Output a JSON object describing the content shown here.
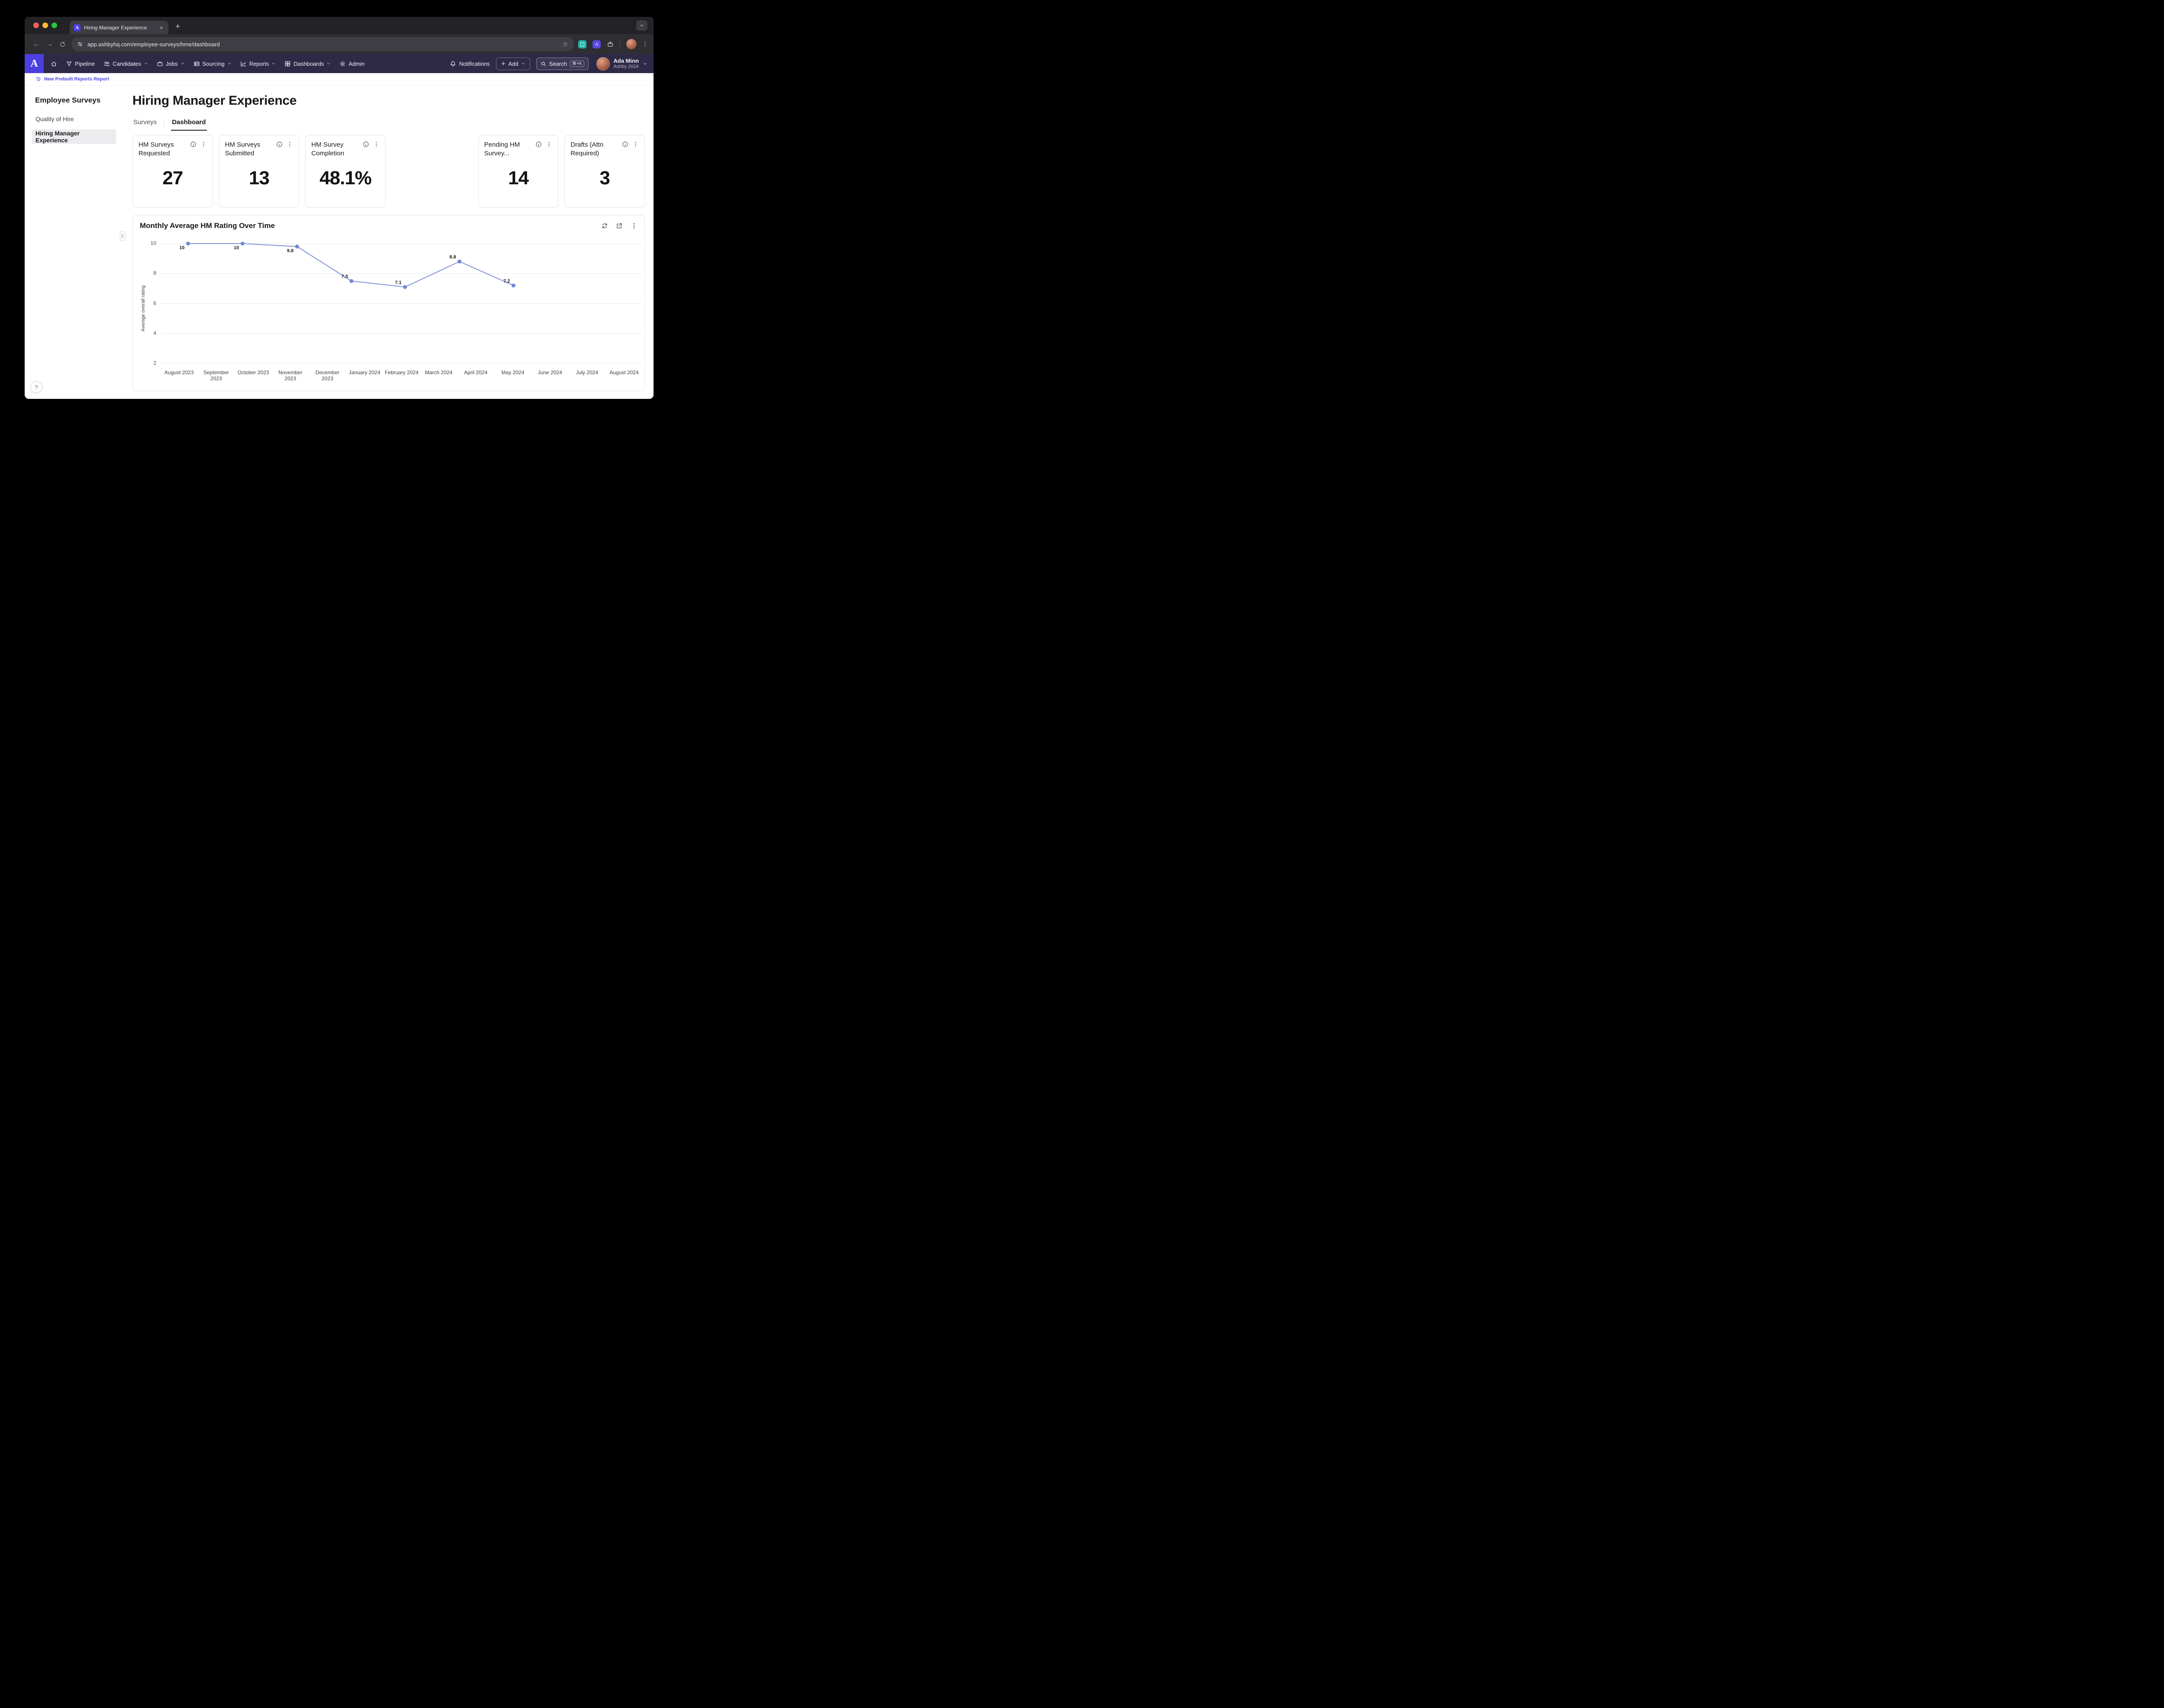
{
  "browser": {
    "tab_title": "Hiring Manager Experience",
    "url": "app.ashbyhq.com/employee-surveys/hme/dashboard"
  },
  "app_nav": {
    "logo_letter": "A",
    "items": [
      {
        "label": "",
        "icon": "home-icon",
        "chevron": false
      },
      {
        "label": "Pipeline",
        "icon": "funnel-icon",
        "chevron": false
      },
      {
        "label": "Candidates",
        "icon": "people-icon",
        "chevron": true
      },
      {
        "label": "Jobs",
        "icon": "briefcase-icon",
        "chevron": true
      },
      {
        "label": "Sourcing",
        "icon": "badge-icon",
        "chevron": true
      },
      {
        "label": "Reports",
        "icon": "reports-icon",
        "chevron": true
      },
      {
        "label": "Dashboards",
        "icon": "dashboards-icon",
        "chevron": true
      },
      {
        "label": "Admin",
        "icon": "gear-icon",
        "chevron": false
      }
    ],
    "notifications_label": "Notifications",
    "add_button": {
      "label": "Add"
    },
    "search": {
      "label": "Search",
      "shortcut": "⌘+K"
    },
    "user": {
      "name": "Ada Minn",
      "org": "Ashby 2024"
    }
  },
  "announcement": {
    "link_label": "New Prebuilt Reports Report"
  },
  "sidebar": {
    "heading": "Employee Surveys",
    "items": [
      {
        "label": "Quality of Hire",
        "active": false
      },
      {
        "label": "Hiring Manager Experience",
        "active": true
      }
    ]
  },
  "page": {
    "title": "Hiring Manager Experience",
    "tabs": [
      {
        "label": "Surveys",
        "active": false
      },
      {
        "label": "Dashboard",
        "active": true
      }
    ],
    "stat_cards": [
      {
        "label": "HM Surveys Requested",
        "value": "27",
        "slot": 1
      },
      {
        "label": "HM Surveys Submitted",
        "value": "13",
        "slot": 2
      },
      {
        "label": "HM Survey Completion",
        "value": "48.1%",
        "slot": 3
      },
      {
        "label": "Pending HM Survey...",
        "value": "14",
        "slot": 5
      },
      {
        "label": "Drafts (Attn Required)",
        "value": "3",
        "slot": 6
      }
    ]
  },
  "chart_data": {
    "type": "line",
    "title": "Monthly Average HM Rating Over Time",
    "ylabel": "Average overall rating",
    "y_ticks": [
      10,
      8,
      6,
      4,
      2
    ],
    "ylim": [
      2,
      10
    ],
    "grid": true,
    "legend": false,
    "line_color": "#7d93dc",
    "point_color": "#7186d4",
    "x_labels": [
      "August 2023",
      "September 2023",
      "October 2023",
      "November 2023",
      "December 2023",
      "January 2024",
      "February 2024",
      "March 2024",
      "April 2024",
      "May 2024",
      "June 2024",
      "July 2024",
      "August 2024"
    ],
    "series": [
      {
        "name": "Average overall rating",
        "points": [
          {
            "month": "August 2023",
            "value": 10,
            "x_frac": 0.057
          },
          {
            "month": "October 2023",
            "value": 10,
            "x_frac": 0.17
          },
          {
            "month": "November 2023",
            "value": 9.8,
            "x_frac": 0.283
          },
          {
            "month": "January 2024",
            "value": 7.5,
            "x_frac": 0.396
          },
          {
            "month": "February 2024",
            "value": 7.1,
            "x_frac": 0.507
          },
          {
            "month": "April 2024",
            "value": 8.8,
            "x_frac": 0.62
          },
          {
            "month": "May 2024",
            "value": 7.2,
            "x_frac": 0.732
          }
        ]
      }
    ]
  },
  "colors": {
    "accent_purple": "#4f43e0",
    "nav_bg": "#2d2947",
    "line": "#7d93dc"
  }
}
